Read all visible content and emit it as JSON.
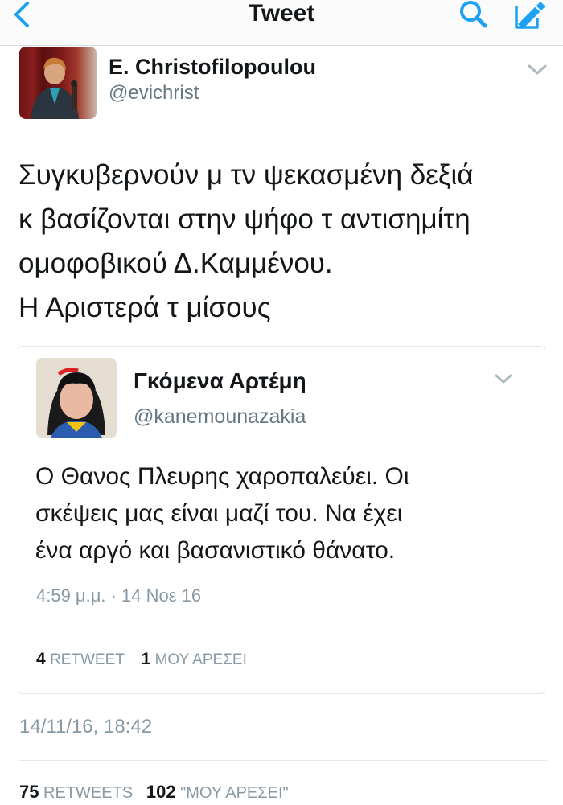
{
  "nav": {
    "title": "Tweet"
  },
  "author": {
    "name": "E. Christofilopoulou",
    "handle": "@evichrist"
  },
  "tweet": {
    "lines": [
      "Συγκυβερνούν μ τν ψεκασμένη δεξιά",
      "κ βασίζονται στην ψήφο τ αντισημίτη",
      "ομοφοβικού Δ.Καμμένου.",
      "Η Αριστερά τ μίσους"
    ],
    "timestamp": "14/11/16, 18:42",
    "retweets_count": "75",
    "retweets_label": "RETWEETS",
    "likes_count": "102",
    "likes_label": "\"ΜΟΥ ΑΡΕΣΕΙ\""
  },
  "quoted": {
    "name": "Γκόμενα Αρτέμη",
    "handle": "@kanemounazakia",
    "lines": [
      "Ο Θανος Πλευρης χαροπαλεύει. Οι",
      "σκέψεις μας είναι μαζί του. Να έχει",
      "ένα αργό και βασανιστικό θάνατο."
    ],
    "timestamp": "4:59 μ.μ. · 14 Νοε 16",
    "retweets_count": "4",
    "retweets_label": "RETWEET",
    "likes_count": "1",
    "likes_label": "ΜΟΥ ΑΡΕΣΕΙ"
  },
  "colors": {
    "accent": "#1da1f2",
    "text": "#14171a",
    "muted": "#8899a6",
    "divider": "#e1e8ed"
  },
  "icons": [
    "back-chevron-icon",
    "search-icon",
    "compose-icon",
    "caret-down-icon"
  ]
}
